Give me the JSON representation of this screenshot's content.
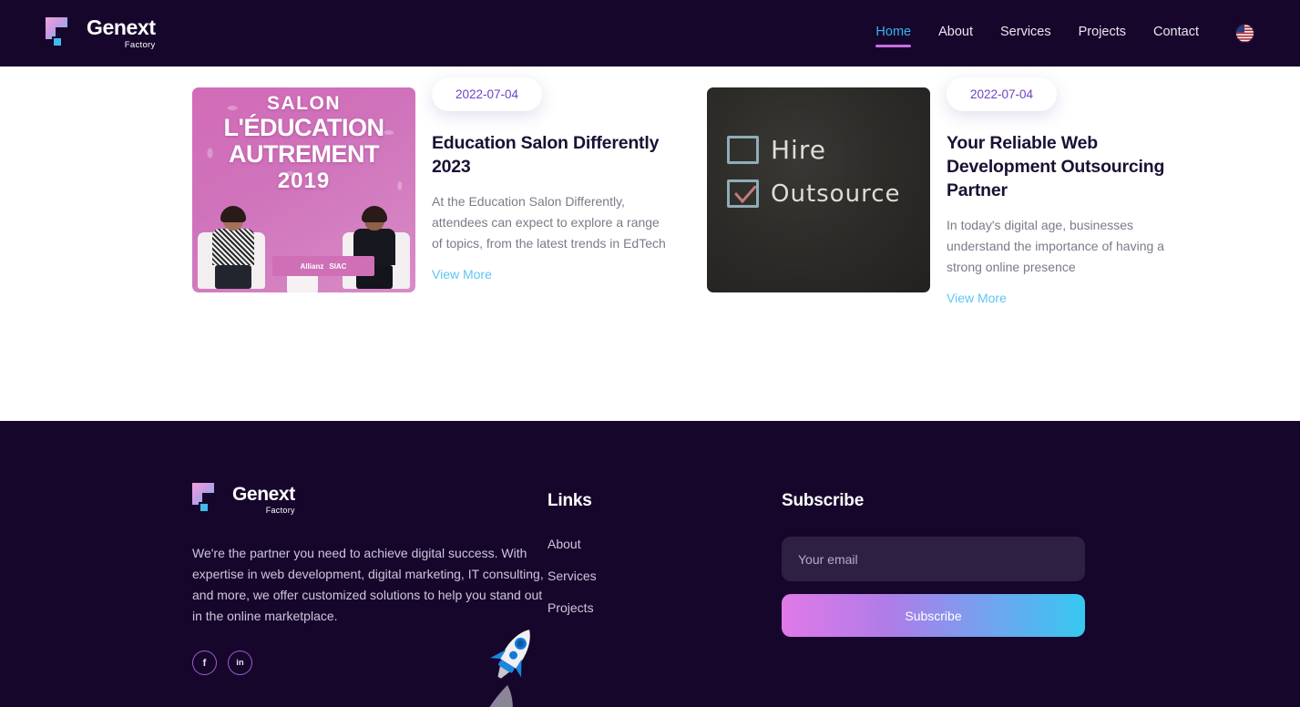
{
  "brand": {
    "name": "Genext",
    "sub": "Factory",
    "logo_icon": "genext-blocks-logo-icon",
    "gradient_start": "#efa3d6",
    "gradient_end": "#57c7f2"
  },
  "header": {
    "bg": "#16062b",
    "nav": [
      {
        "label": "Home",
        "active": true
      },
      {
        "label": "About",
        "active": false
      },
      {
        "label": "Services",
        "active": false
      },
      {
        "label": "Projects",
        "active": false
      },
      {
        "label": "Contact",
        "active": false
      }
    ],
    "active_color": "#32b4f2",
    "underline_color": "#c86fe0",
    "language_icon": "us-flag-icon"
  },
  "blog": {
    "view_more_color": "#5cc6f4",
    "date_color": "#6d42c8",
    "cards": [
      {
        "date": "2022-07-04",
        "title": "Education Salon Differently 2023",
        "description": "At the Education Salon Differently, attendees can expect to explore a range of topics, from the latest trends in EdTech",
        "link_label": "View More",
        "image_alt": "salon-education-autrement-poster-image",
        "poster": {
          "line1": "SALON",
          "line2": "L'ÉDUCATION",
          "line3": "AUTREMENT",
          "line4": "2019",
          "sponsor1": "Allianz",
          "sponsor2": "SIAC"
        }
      },
      {
        "date": "2022-07-04",
        "title": "Your Reliable Web Development Outsourcing Partner",
        "description": "In today's digital age, businesses understand the importance of having a strong online presence",
        "link_label": "View More",
        "image_alt": "chalkboard-hire-outsource-image",
        "chalkboard": {
          "option1": "Hire",
          "option1_checked": false,
          "option2": "Outsource",
          "option2_checked": true
        }
      }
    ]
  },
  "footer": {
    "bg": "#16062b",
    "description": "We're the partner you need to achieve digital success. With expertise in web development, digital marketing, IT consulting, and more, we offer customized solutions to help you stand out in the online marketplace.",
    "socials": [
      {
        "name": "facebook-icon",
        "glyph": "f"
      },
      {
        "name": "linkedin-icon",
        "glyph": "in"
      }
    ],
    "links": {
      "heading": "Links",
      "items": [
        {
          "label": "About"
        },
        {
          "label": "Services"
        },
        {
          "label": "Projects"
        }
      ]
    },
    "subscribe": {
      "heading": "Subscribe",
      "email_value": "",
      "email_placeholder": "Your email",
      "button_label": "Subscribe",
      "button_gradient_start": "#e07ae8",
      "button_gradient_end": "#35c8f0"
    },
    "decoration_icon": "rocket-icon"
  }
}
